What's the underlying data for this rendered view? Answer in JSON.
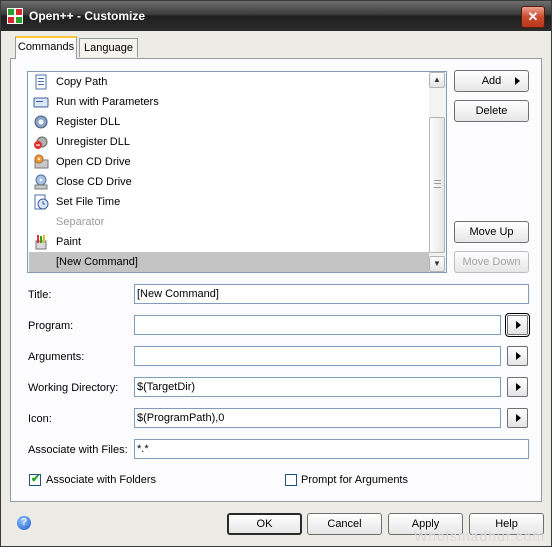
{
  "window": {
    "title": "Open++ - Customize",
    "close_glyph": "✕"
  },
  "tabs": [
    {
      "label": "Commands",
      "active": true
    },
    {
      "label": "Language",
      "active": false
    }
  ],
  "commands_list": {
    "items": [
      {
        "label": "Copy Path",
        "icon": "copy-path-icon"
      },
      {
        "label": "Run with Parameters",
        "icon": "run-parameters-icon"
      },
      {
        "label": "Register DLL",
        "icon": "register-dll-icon"
      },
      {
        "label": "Unregister DLL",
        "icon": "unregister-dll-icon"
      },
      {
        "label": "Open CD Drive",
        "icon": "open-cd-icon"
      },
      {
        "label": "Close CD Drive",
        "icon": "close-cd-icon"
      },
      {
        "label": "Set File Time",
        "icon": "file-time-icon"
      },
      {
        "label": "Separator",
        "icon": "",
        "disabled": true
      },
      {
        "label": "Paint",
        "icon": "paint-icon"
      },
      {
        "label": "[New Command]",
        "icon": "",
        "selected": true
      }
    ]
  },
  "side_buttons": {
    "add": "Add",
    "delete": "Delete",
    "move_up": "Move Up",
    "move_down": "Move Down"
  },
  "form": {
    "title": {
      "label": "Title:",
      "value": "[New Command]"
    },
    "program": {
      "label": "Program:",
      "value": ""
    },
    "arguments": {
      "label": "Arguments:",
      "value": ""
    },
    "working_directory": {
      "label": "Working Directory:",
      "value": "$(TargetDir)"
    },
    "icon": {
      "label": "Icon:",
      "value": "$(ProgramPath),0"
    },
    "associate_files": {
      "label": "Associate with Files:",
      "value": "*.*"
    }
  },
  "options": {
    "associate_folders": {
      "label": "Associate with Folders",
      "checked": true
    },
    "prompt_arguments": {
      "label": "Prompt for Arguments",
      "checked": false
    }
  },
  "footer": {
    "ok": "OK",
    "cancel": "Cancel",
    "apply": "Apply",
    "help": "Help",
    "help_icon_glyph": "?"
  },
  "watermark": "Whoismadhur.com",
  "check_glyph": "✔"
}
